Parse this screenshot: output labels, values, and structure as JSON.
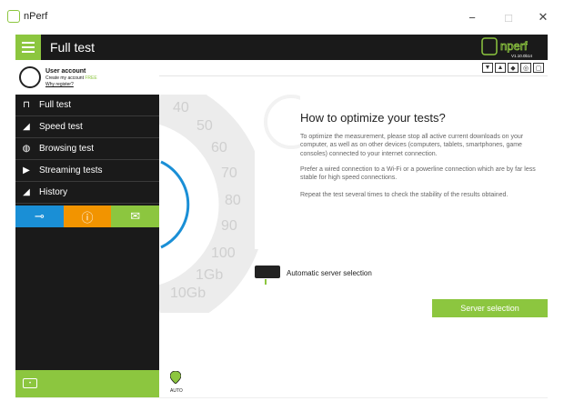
{
  "window": {
    "app_name": "nPerf",
    "minimize": "−",
    "maximize": "□",
    "close": "✕"
  },
  "header": {
    "title": "Full test",
    "logo_text": "nperf",
    "version": "V1.10.0b14"
  },
  "account": {
    "title": "User account",
    "create_text": "Create my account",
    "free_badge": "FREE",
    "register_link": "Why register?"
  },
  "lang_buttons": [
    "▼",
    "▲",
    "◆",
    "◎",
    "▢"
  ],
  "sidebar": {
    "items": [
      {
        "label": "Full test",
        "icon": "nperf-icon"
      },
      {
        "label": "Speed test",
        "icon": "speedometer-icon"
      },
      {
        "label": "Browsing test",
        "icon": "globe-icon"
      },
      {
        "label": "Streaming tests",
        "icon": "play-icon"
      },
      {
        "label": "History",
        "icon": "history-icon"
      }
    ],
    "action_buttons": [
      {
        "icon": "wrench-icon",
        "color": "#1a8fd6"
      },
      {
        "icon": "info-icon",
        "color": "#f29400"
      },
      {
        "icon": "mail-icon",
        "color": "#8cc63f"
      }
    ]
  },
  "gauge": {
    "labels": [
      "40",
      "50",
      "60",
      "70",
      "80",
      "90",
      "100",
      "1Gb",
      "10Gb"
    ]
  },
  "tips": {
    "title": "How to optimize your tests?",
    "p1": "To optimize the measurement, please stop all active current downloads on your computer, as well as on other devices (computers, tablets, smartphones, game consoles) connected to your internet connection.",
    "p2": "Prefer a wired connection to a Wi-Fi or a powerline connection which are by far less stable for high speed connections.",
    "p3": "Repeat the test several times to check the stability of the results obtained."
  },
  "server": {
    "label": "Automatic server selection",
    "button": "Server selection"
  },
  "footer": {
    "auto_label": "AUTO"
  },
  "colors": {
    "accent": "#8cc63f",
    "dark": "#1a1a1a"
  }
}
